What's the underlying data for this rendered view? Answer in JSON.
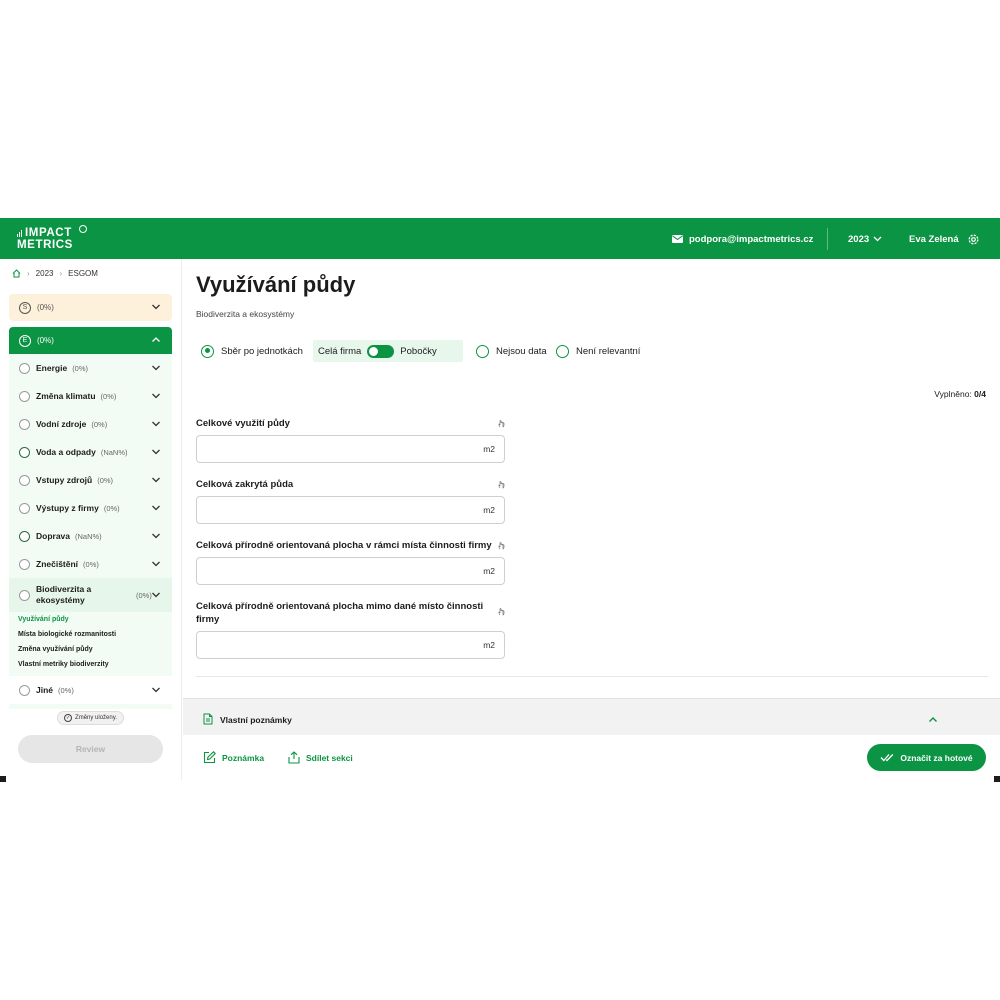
{
  "header": {
    "logo_line1": "IMPACT",
    "logo_line2": "METRICS",
    "email": "podpora@impactmetrics.cz",
    "year": "2023",
    "user": "Eva Zelená"
  },
  "breadcrumb": [
    "2023",
    "ESGOM"
  ],
  "sidebar": {
    "section_s": {
      "letter": "S",
      "pct": "(0%)"
    },
    "section_e": {
      "letter": "E",
      "pct": "(0%)"
    },
    "categories": [
      {
        "name": "Energie",
        "pct": "(0%)"
      },
      {
        "name": "Změna klimatu",
        "pct": "(0%)"
      },
      {
        "name": "Vodní zdroje",
        "pct": "(0%)"
      },
      {
        "name": "Voda a odpady",
        "pct": "(NaN%)"
      },
      {
        "name": "Vstupy zdrojů",
        "pct": "(0%)"
      },
      {
        "name": "Výstupy z firmy",
        "pct": "(0%)"
      },
      {
        "name": "Doprava",
        "pct": "(NaN%)"
      },
      {
        "name": "Znečištění",
        "pct": "(0%)"
      }
    ],
    "active_category": {
      "name": "Biodiverzita a ekosystémy",
      "pct": "(0%)"
    },
    "subitems": [
      "Využívání půdy",
      "Místa biologické rozmanitosti",
      "Změna využívání půdy",
      "Vlastní metriky biodiverzity"
    ],
    "other": {
      "name": "Jiné",
      "pct": "(0%)"
    },
    "saved": "Změny uloženy.",
    "review": "Review"
  },
  "main": {
    "title": "Využívání půdy",
    "subtitle": "Biodiverzita a ekosystémy",
    "options": {
      "per_unit": "Sběr po jednotkách",
      "whole_firm": "Celá firma",
      "branches": "Pobočky",
      "no_data": "Nejsou data",
      "not_relevant": "Není relevantní"
    },
    "filled_label": "Vyplněno:",
    "filled_value": "0/4",
    "fields": [
      {
        "label": "Celkové využití půdy",
        "value": "",
        "unit": "m2"
      },
      {
        "label": "Celková zakrytá půda",
        "value": "",
        "unit": "m2"
      },
      {
        "label": "Celková přírodně orientovaná plocha v rámci místa činnosti firmy",
        "value": "",
        "unit": "m2"
      },
      {
        "label": "Celková přírodně orientovaná plocha mimo dané místo činnosti firmy",
        "value": "",
        "unit": "m2"
      }
    ],
    "notes_label": "Vlastní poznámky",
    "note_action": "Poznámka",
    "share_action": "Sdílet sekci",
    "mark_done": "Označit za hotové"
  },
  "colors": {
    "brand": "#0b9444",
    "s_section_bg": "#fdf1dc",
    "list_bg": "#f3fbf5"
  }
}
